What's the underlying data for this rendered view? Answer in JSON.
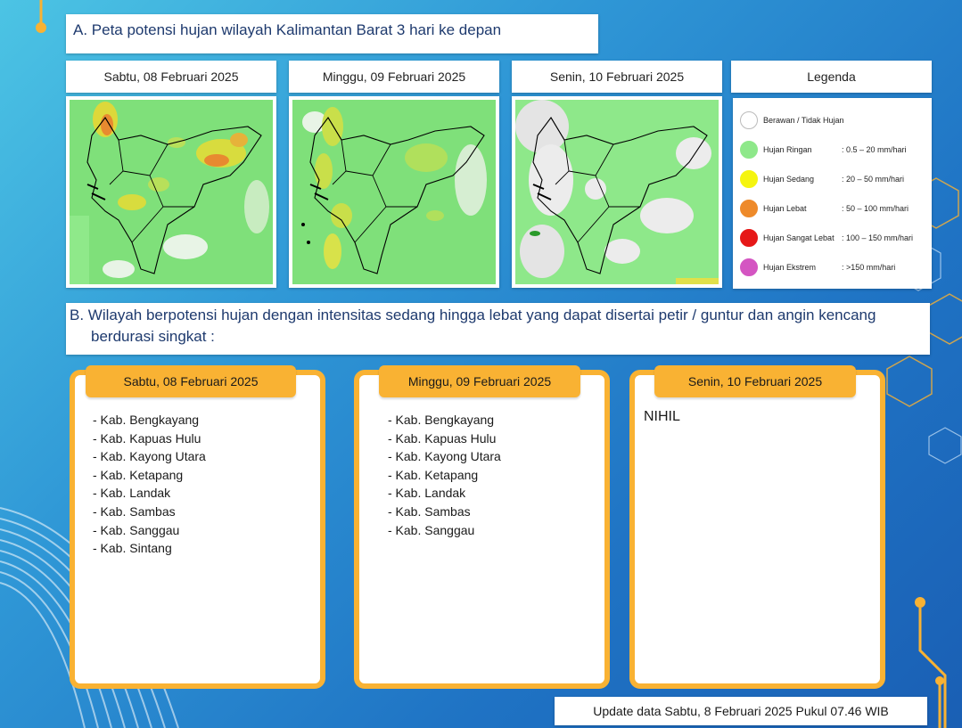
{
  "section_a": {
    "title": "A. Peta potensi hujan wilayah Kalimantan Barat 3 hari ke depan"
  },
  "maps": [
    {
      "date": "Sabtu, 08 Februari 2025"
    },
    {
      "date": "Minggu, 09 Februari 2025"
    },
    {
      "date": "Senin, 10 Februari 2025"
    }
  ],
  "legend": {
    "title": "Legenda",
    "items": [
      {
        "name": "Berawan / Tidak Hujan",
        "range": "",
        "color": "#ffffff"
      },
      {
        "name": "Hujan Ringan",
        "range": ": 0.5 – 20 mm/hari",
        "color": "#8ee88a"
      },
      {
        "name": "Hujan Sedang",
        "range": ": 20 – 50 mm/hari",
        "color": "#f5f510"
      },
      {
        "name": "Hujan Lebat",
        "range": ": 50 – 100 mm/hari",
        "color": "#ee8a2a"
      },
      {
        "name": "Hujan Sangat Lebat",
        "range": ": 100 – 150 mm/hari",
        "color": "#e61818"
      },
      {
        "name": "Hujan Ekstrem",
        "range": ": >150 mm/hari",
        "color": "#d455c2"
      }
    ]
  },
  "section_b": {
    "title_line1": "B. Wilayah berpotensi hujan dengan intensitas sedang hingga lebat yang dapat disertai petir / guntur dan angin kencang",
    "title_line2": "berdurasi singkat :"
  },
  "cards": [
    {
      "date": "Sabtu, 08 Februari 2025",
      "regions": [
        "- Kab. Bengkayang",
        "- Kab. Kapuas Hulu",
        "- Kab. Kayong Utara",
        "- Kab. Ketapang",
        "- Kab. Landak",
        "- Kab. Sambas",
        "- Kab. Sanggau",
        "- Kab. Sintang"
      ]
    },
    {
      "date": "Minggu, 09 Februari 2025",
      "regions": [
        "- Kab. Bengkayang",
        "- Kab. Kapuas Hulu",
        "- Kab. Kayong Utara",
        "- Kab. Ketapang",
        "- Kab. Landak",
        "- Kab. Sambas",
        "- Kab. Sanggau"
      ]
    },
    {
      "date": "Senin, 10 Februari 2025",
      "nihil": "NIHIL"
    }
  ],
  "footer": {
    "update_text": "Update data Sabtu, 8 Februari 2025 Pukul 07.46 WIB"
  }
}
